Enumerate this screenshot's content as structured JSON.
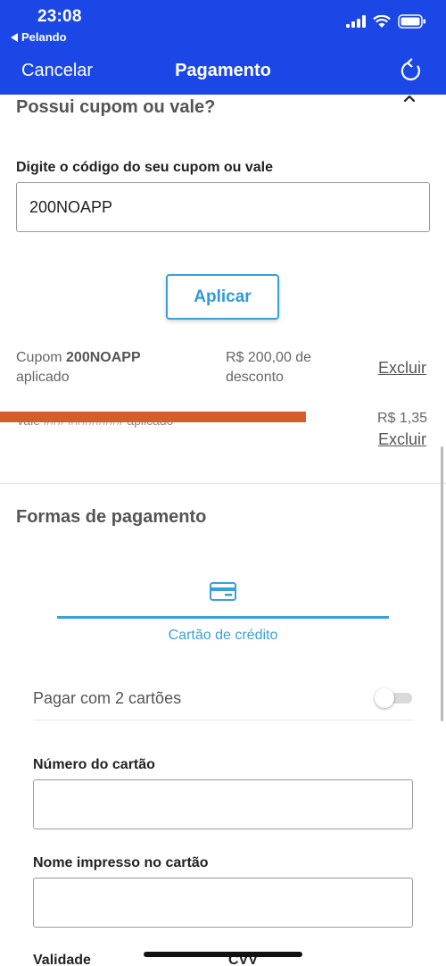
{
  "status_bar": {
    "time": "23:08",
    "back_app": "Pelando",
    "icons": [
      "signal-icon",
      "wifi-icon",
      "battery-icon"
    ]
  },
  "nav": {
    "cancel": "Cancelar",
    "title": "Pagamento",
    "refresh_icon": "refresh-icon",
    "bg_color": "#1a47e6"
  },
  "coupon": {
    "title": "Possui cupom ou vale?",
    "input_label": "Digite o código do seu cupom ou vale",
    "input_value": "200NOAPP",
    "apply_button": "Aplicar",
    "applied": {
      "prefix": "Cupom",
      "code": "200NOAPP",
      "suffix": "aplicado",
      "discount_line1": "R$ 200,00 de",
      "discount_line2": "desconto",
      "remove": "Excluir"
    },
    "voucher": {
      "redacted_text": "Vale ### ######## aplicado",
      "amount": "R$ 1,35",
      "remove": "Excluir"
    }
  },
  "payment": {
    "title": "Formas de pagamento",
    "tab_label": "Cartão de crédito",
    "accent_color": "#3aa0d8",
    "two_cards_label": "Pagar com 2 cartões",
    "two_cards_enabled": false,
    "card_number_label": "Número do cartão",
    "card_name_label": "Nome impresso no cartão",
    "expiry_label": "Validade",
    "cvv_label": "CVV"
  }
}
